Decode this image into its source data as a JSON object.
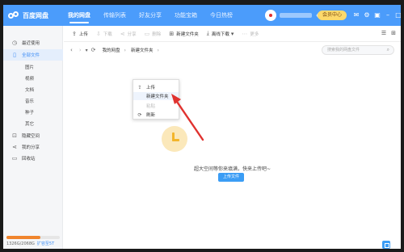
{
  "app": {
    "title": "百度网盘",
    "nav": [
      "我的网盘",
      "传输列表",
      "好友分享",
      "功能宝箱",
      "今日热榜"
    ],
    "vip_label": "会员中心"
  },
  "sidebar": {
    "items": [
      {
        "label": "最近使用",
        "icon": "clock-icon",
        "glyph": "◷"
      },
      {
        "label": "全部文件",
        "icon": "file-icon",
        "glyph": "▯"
      },
      {
        "label": "图片"
      },
      {
        "label": "视频"
      },
      {
        "label": "文档"
      },
      {
        "label": "音乐"
      },
      {
        "label": "种子"
      },
      {
        "label": "其它"
      },
      {
        "label": "隐藏空间",
        "icon": "lock-icon",
        "glyph": "⊡"
      },
      {
        "label": "我的分享",
        "icon": "share-icon",
        "glyph": "⋖"
      },
      {
        "label": "回收站",
        "icon": "trash-icon",
        "glyph": "▭"
      }
    ],
    "quota_text": "1326G/2068G",
    "quota_fraction": 0.64,
    "quota_link": "扩容至5T"
  },
  "toolbar": {
    "upload": "上传",
    "download": "下载",
    "share": "分享",
    "delete": "删除",
    "new_folder": "新建文件夹",
    "offline_download": "离线下载",
    "more": "更多"
  },
  "path": {
    "crumbs": [
      "我的网盘",
      "新建文件夹"
    ],
    "search_placeholder": "搜索我的网盘文件"
  },
  "empty": {
    "message": "超大空间等你来填满，快来上传吧~",
    "upload_button": "上传文件"
  },
  "context_menu": {
    "items": [
      {
        "label": "上传",
        "icon": "upload-icon",
        "glyph": "⇪"
      },
      {
        "label": "新建文件夹"
      },
      {
        "label": "粘贴",
        "disabled": true
      },
      {
        "label": "刷新",
        "icon": "refresh-icon",
        "glyph": "⟳"
      }
    ]
  },
  "colors": {
    "brand": "#4b9cfb",
    "accent": "#3b9df5",
    "arrow": "#e0322f",
    "vip": "#fdd96b",
    "quota": "#f0852d"
  }
}
